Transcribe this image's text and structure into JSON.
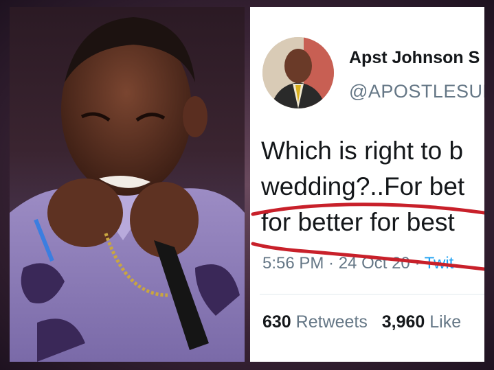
{
  "tweet": {
    "display_name": "Apst Johnson S",
    "handle": "@APOSTLESUL",
    "text_line1": "Which is right to b",
    "text_line2": "wedding?..For bet",
    "text_line3": "for better for best",
    "time": "5:56 PM · 24 Oct 20 · ",
    "via": "Twit",
    "retweets_count": "630",
    "retweets_label": " Retweets",
    "likes_count": "3,960",
    "likes_label": " Like"
  },
  "colors": {
    "underline": "#c8202a",
    "link": "#1da1f2",
    "muted": "#657786"
  }
}
